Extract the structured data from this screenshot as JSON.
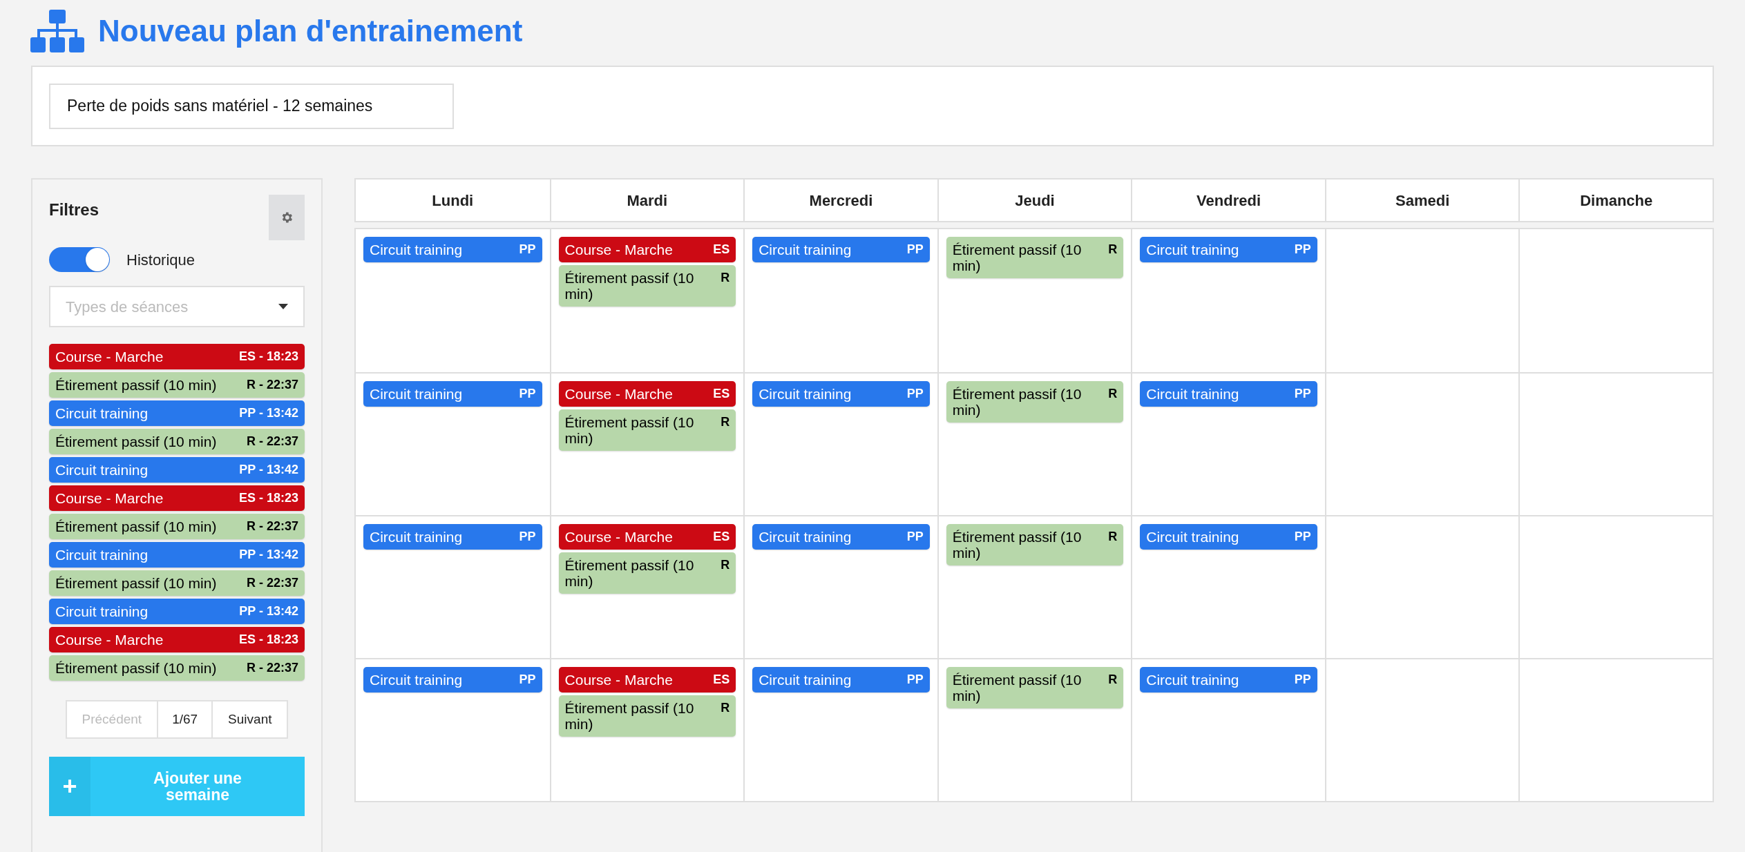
{
  "title": "Nouveau plan d'entrainement",
  "plan_name": {
    "value": "Perte de poids sans matériel - 12 semaines"
  },
  "filters": {
    "title": "Filtres",
    "history_toggle": {
      "label": "Historique",
      "on": true
    },
    "session_type_select": {
      "placeholder": "Types de séances"
    },
    "sessions": [
      {
        "label": "Course - Marche",
        "tag": "ES - 18:23",
        "color": "#cc0a14"
      },
      {
        "label": "Étirement passif (10 min)",
        "tag": "R - 22:37",
        "color": "#b7d7aa"
      },
      {
        "label": "Circuit training",
        "tag": "PP - 13:42",
        "color": "#2878ec"
      },
      {
        "label": "Étirement passif (10 min)",
        "tag": "R - 22:37",
        "color": "#b7d7aa"
      },
      {
        "label": "Circuit training",
        "tag": "PP - 13:42",
        "color": "#2878ec"
      },
      {
        "label": "Course - Marche",
        "tag": "ES - 18:23",
        "color": "#cc0a14"
      },
      {
        "label": "Étirement passif (10 min)",
        "tag": "R - 22:37",
        "color": "#b7d7aa"
      },
      {
        "label": "Circuit training",
        "tag": "PP - 13:42",
        "color": "#2878ec"
      },
      {
        "label": "Étirement passif (10 min)",
        "tag": "R - 22:37",
        "color": "#b7d7aa"
      },
      {
        "label": "Circuit training",
        "tag": "PP - 13:42",
        "color": "#2878ec"
      },
      {
        "label": "Course - Marche",
        "tag": "ES - 18:23",
        "color": "#cc0a14"
      },
      {
        "label": "Étirement passif (10 min)",
        "tag": "R - 22:37",
        "color": "#b7d7aa"
      }
    ],
    "pagination": {
      "previous": {
        "label": "Précédent",
        "disabled": true
      },
      "page": "1/67",
      "next": {
        "label": "Suivant",
        "disabled": false
      }
    },
    "add_week_button": {
      "icon": "+",
      "label": "Ajouter une semaine"
    }
  },
  "calendar": {
    "days": [
      "Lundi",
      "Mardi",
      "Mercredi",
      "Jeudi",
      "Vendredi",
      "Samedi",
      "Dimanche"
    ],
    "weeks": [
      [
        [
          {
            "label": "Circuit training",
            "tag": "PP",
            "color": "#2878ec"
          }
        ],
        [
          {
            "label": "Course - Marche",
            "tag": "ES",
            "color": "#cc0a14"
          },
          {
            "label": "Étirement passif (10 min)",
            "tag": "R",
            "color": "#b7d7aa"
          }
        ],
        [
          {
            "label": "Circuit training",
            "tag": "PP",
            "color": "#2878ec"
          }
        ],
        [
          {
            "label": "Étirement passif (10 min)",
            "tag": "R",
            "color": "#b7d7aa"
          }
        ],
        [
          {
            "label": "Circuit training",
            "tag": "PP",
            "color": "#2878ec"
          }
        ]
      ],
      [
        [
          {
            "label": "Circuit training",
            "tag": "PP",
            "color": "#2878ec"
          }
        ],
        [
          {
            "label": "Course - Marche",
            "tag": "ES",
            "color": "#cc0a14"
          },
          {
            "label": "Étirement passif (10 min)",
            "tag": "R",
            "color": "#b7d7aa"
          }
        ],
        [
          {
            "label": "Circuit training",
            "tag": "PP",
            "color": "#2878ec"
          }
        ],
        [
          {
            "label": "Étirement passif (10 min)",
            "tag": "R",
            "color": "#b7d7aa"
          }
        ],
        [
          {
            "label": "Circuit training",
            "tag": "PP",
            "color": "#2878ec"
          }
        ]
      ],
      [
        [
          {
            "label": "Circuit training",
            "tag": "PP",
            "color": "#2878ec"
          }
        ],
        [
          {
            "label": "Course - Marche",
            "tag": "ES",
            "color": "#cc0a14"
          },
          {
            "label": "Étirement passif (10 min)",
            "tag": "R",
            "color": "#b7d7aa"
          }
        ],
        [
          {
            "label": "Circuit training",
            "tag": "PP",
            "color": "#2878ec"
          }
        ],
        [
          {
            "label": "Étirement passif (10 min)",
            "tag": "R",
            "color": "#b7d7aa"
          }
        ],
        [
          {
            "label": "Circuit training",
            "tag": "PP",
            "color": "#2878ec"
          }
        ]
      ],
      [
        [
          {
            "label": "Circuit training",
            "tag": "PP",
            "color": "#2878ec"
          }
        ],
        [
          {
            "label": "Course - Marche",
            "tag": "ES",
            "color": "#cc0a14"
          },
          {
            "label": "Étirement passif (10 min)",
            "tag": "R",
            "color": "#b7d7aa"
          }
        ],
        [
          {
            "label": "Circuit training",
            "tag": "PP",
            "color": "#2878ec"
          }
        ],
        [
          {
            "label": "Étirement passif (10 min)",
            "tag": "R",
            "color": "#b7d7aa"
          }
        ],
        [
          {
            "label": "Circuit training",
            "tag": "PP",
            "color": "#2878ec"
          }
        ]
      ]
    ]
  }
}
